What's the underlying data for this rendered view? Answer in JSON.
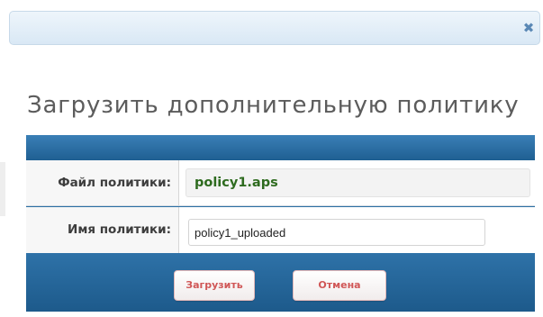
{
  "dialog": {
    "close_icon": "close-icon",
    "close_glyph": "✖",
    "heading": "Загрузить дополнительную политику"
  },
  "form": {
    "file_label": "Файл политики:",
    "file_value": "policy1.aps",
    "name_label": "Имя политики:",
    "name_value": "policy1_uploaded"
  },
  "buttons": {
    "upload_label": "Загрузить",
    "cancel_label": "Отмена"
  },
  "colors": {
    "accent": "#2c6fa3",
    "button_text": "#d05757",
    "file_value_text": "#2e6b1f"
  }
}
